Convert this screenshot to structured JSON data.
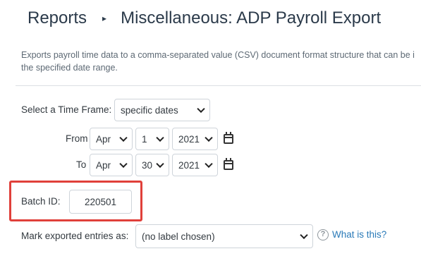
{
  "breadcrumb": {
    "root": "Reports",
    "separator": "▸",
    "current": "Miscellaneous: ADP Payroll Export"
  },
  "description": "Exports payroll time data to a comma-separated value (CSV) document format structure that can be i the specified date range.",
  "description_lines": [
    "Exports payroll time data to a comma-separated value (CSV) document format structure that can be i",
    "the specified date range."
  ],
  "timeframe": {
    "label": "Select a Time Frame:",
    "selected": "specific dates"
  },
  "from": {
    "label": "From",
    "month": "Apr",
    "day": "1",
    "year": "2021"
  },
  "to": {
    "label": "To",
    "month": "Apr",
    "day": "30",
    "year": "2021"
  },
  "batch": {
    "label": "Batch ID:",
    "value": "220501",
    "highlight_color": "#e0403a"
  },
  "mark": {
    "label": "Mark exported entries as:",
    "selected": "(no label chosen)",
    "help_link": "What is this?"
  },
  "icons": {
    "calendar": "calendar-icon",
    "help": "question-circle-icon"
  },
  "colors": {
    "link": "#2a7ab8",
    "heading": "#2b3a4a"
  }
}
